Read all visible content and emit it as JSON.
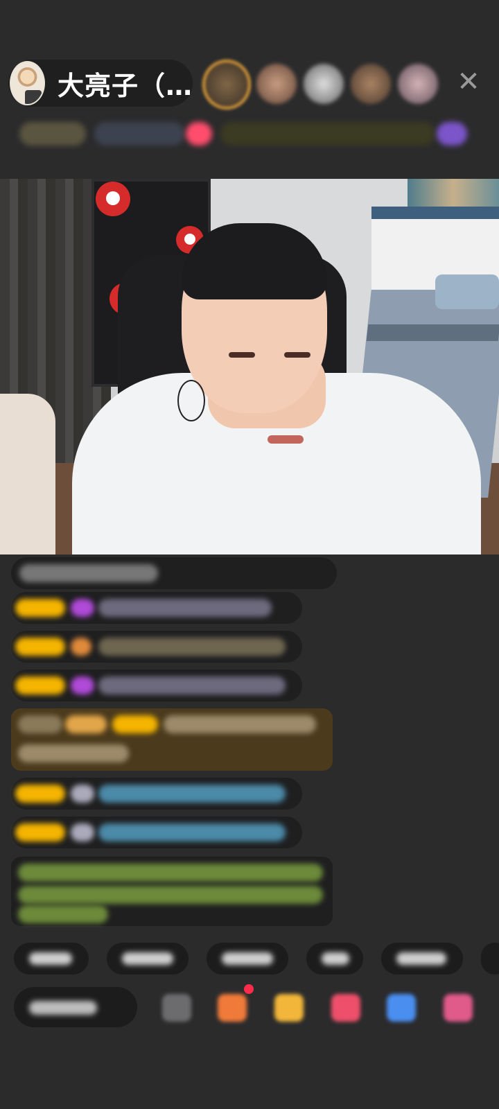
{
  "host": {
    "name": "大亮子（…",
    "close_symbol": "✕"
  },
  "colors": {
    "background": "#2b2b2c",
    "pill": "#1f1f20",
    "rank_ring": "#f0a93a",
    "highlight_message": "#4b3a1c",
    "level_badge": "#f4b400",
    "welcome_text": "#8bc34a"
  },
  "icons": {
    "close": "close-icon",
    "emoji": "emoji-icon",
    "gift": "gift-icon",
    "lucky_bag": "lucky-bag-icon",
    "heart": "heart-icon",
    "game": "game-icon",
    "more": "more-icon"
  }
}
